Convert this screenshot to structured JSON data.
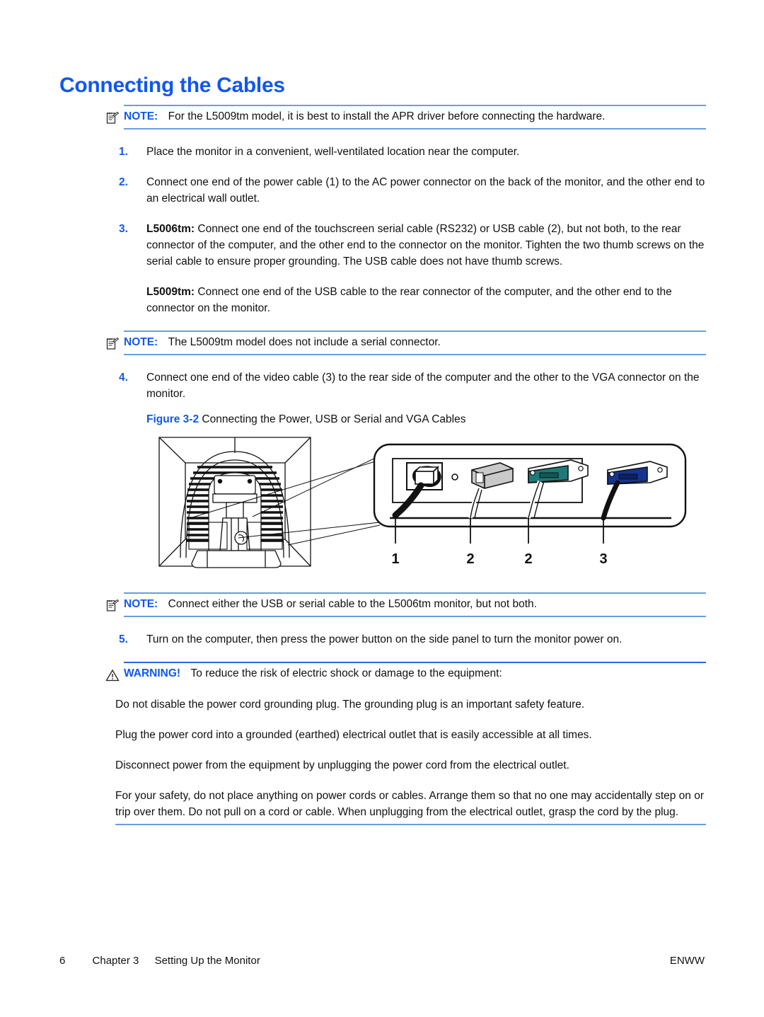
{
  "title": "Connecting the Cables",
  "notes": {
    "note1": {
      "keyword": "NOTE:",
      "text": "For the L5009tm model, it is best to install the APR driver before connecting the hardware."
    },
    "note2": {
      "keyword": "NOTE:",
      "text": "The L5009tm model does not include a serial connector."
    },
    "note3": {
      "keyword": "NOTE:",
      "text": "Connect either the USB or serial cable to the L5006tm monitor, but not both."
    },
    "warning": {
      "keyword": "WARNING!",
      "text": "To reduce the risk of electric shock or damage to the equipment:"
    }
  },
  "steps": [
    {
      "num": "1.",
      "text": "Place the monitor in a convenient, well-ventilated location near the computer."
    },
    {
      "num": "2.",
      "text": "Connect one end of the power cable (1) to the AC power connector on the back of the monitor, and the other end to an electrical wall outlet."
    },
    {
      "num": "3.",
      "bold_lead": "L5006tm:",
      "text": "Connect one end of the touchscreen serial cable (RS232) or USB cable (2), but not both, to the rear connector of the computer, and the other end to the connector on the monitor. Tighten the two thumb screws on the serial cable to ensure proper grounding. The USB cable does not have thumb screws."
    },
    {
      "num": "4.",
      "text": "Connect one end of the video cable (3) to the rear side of the computer and the other to the VGA connector on the monitor."
    },
    {
      "num": "5.",
      "text": "Turn on the computer, then press the power button on the side panel to turn the monitor power on."
    }
  ],
  "paragraphs": {
    "l5009tm_lead": "L5009tm:",
    "l5009tm_text": "Connect one end of the USB cable to the rear connector of the computer, and the other end to the connector on the monitor.",
    "warn1": "Do not disable the power cord grounding plug. The grounding plug is an important safety feature.",
    "warn2": "Plug the power cord into a grounded (earthed) electrical outlet that is easily accessible at all times.",
    "warn3": "Disconnect power from the equipment by unplugging the power cord from the electrical outlet.",
    "warn4": "For your safety, do not place anything on power cords or cables. Arrange them so that no one may accidentally step on or trip over them. Do not pull on a cord or cable. When unplugging from the electrical outlet, grasp the cord by the plug."
  },
  "figure": {
    "label": "Figure 3-2",
    "caption": "Connecting the Power, USB or Serial and VGA Cables",
    "callouts": [
      "1",
      "2",
      "2",
      "3"
    ],
    "connector_colors": {
      "power_cable": "#111111",
      "usb_connector": "#b9b9b9",
      "serial_connector": "#1d7a78",
      "vga_connector": "#16348f"
    }
  },
  "footer": {
    "page_number": "6",
    "chapter": "Chapter 3",
    "chapter_title": "Setting Up the Monitor",
    "locale": "ENWW"
  },
  "colors": {
    "heading_blue": "#1157f0",
    "rule_blue": "#6a9ede",
    "warning_rule_blue": "#1c6fe2"
  }
}
